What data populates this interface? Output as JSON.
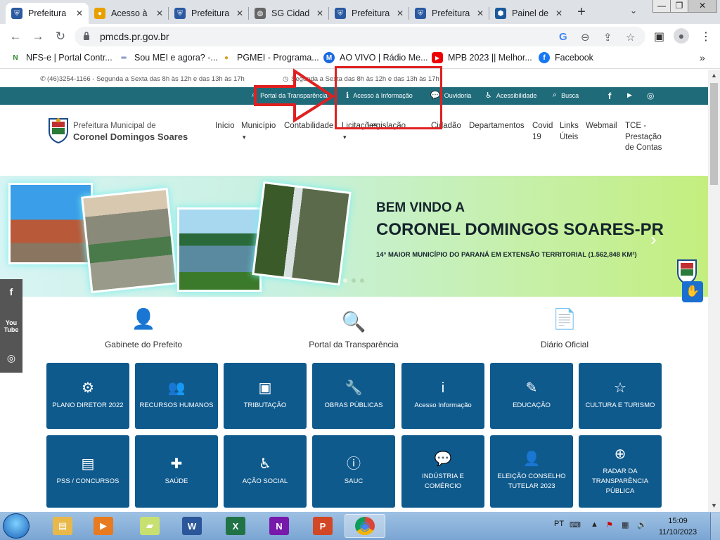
{
  "browser": {
    "tabs": [
      {
        "title": "Prefeitura",
        "active": true,
        "icon": "coat-of-arms-icon"
      },
      {
        "title": "Acesso à",
        "icon": "magnifier-icon"
      },
      {
        "title": "Prefeitura",
        "icon": "coat-of-arms-icon"
      },
      {
        "title": "SG Cidad",
        "icon": "globe-icon"
      },
      {
        "title": "Prefeitura",
        "icon": "coat-of-arms-icon"
      },
      {
        "title": "Prefeitura",
        "icon": "coat-of-arms-icon"
      },
      {
        "title": "Painel de",
        "icon": "hexagon-icon"
      }
    ],
    "new_tab": "+",
    "window_controls": {
      "minimize": "—",
      "restore": "❐",
      "close": "✕"
    },
    "url": "pmcds.pr.gov.br",
    "bookmarks": [
      {
        "label": "NFS-e | Portal Contr...",
        "icon": "nfse-icon"
      },
      {
        "label": "Sou MEI e agora? -...",
        "icon": "mei-icon"
      },
      {
        "label": "PGMEI - Programa...",
        "icon": "pgmei-icon"
      },
      {
        "label": "AO VIVO | Rádio Me...",
        "icon": "radio-icon"
      },
      {
        "label": "MPB 2023 || Melhor...",
        "icon": "youtube-icon"
      },
      {
        "label": "Facebook",
        "icon": "facebook-icon"
      }
    ],
    "bookmarks_more": "»"
  },
  "site": {
    "info_left": "(46)3254-1166 - Segunda a Sexta das 8h às 12h e das 13h às 17h",
    "info_right": "Segunda a Sexta das 8h às 12h e das 13h às 17h",
    "topnav": [
      {
        "label": "Portal da Transparência",
        "icon": "search-icon"
      },
      {
        "label": "Acesso à Informação",
        "icon": "info-icon"
      },
      {
        "label": "Ouvidoria",
        "icon": "chat-icon"
      },
      {
        "label": "Acessibilidade",
        "icon": "wheelchair-icon"
      },
      {
        "label": "Busca",
        "icon": "search-icon"
      }
    ],
    "logo_line1": "Prefeitura Municipal de",
    "logo_line2": "Coronel Domingos Soares",
    "menu": [
      {
        "label": "Início"
      },
      {
        "label": "Município",
        "caret": "▾"
      },
      {
        "label": "Contabilidade"
      },
      {
        "label": "Licitações",
        "caret": "▾"
      },
      {
        "label": "Legislação"
      },
      {
        "label": "Cidadão"
      },
      {
        "label": "Departamentos"
      },
      {
        "label": "Covid 19"
      },
      {
        "label": "Links Úteis"
      },
      {
        "label": "Webmail"
      },
      {
        "label": "TCE - Prestação de Contas"
      }
    ],
    "banner": {
      "line1": "BEM VINDO A",
      "line2": "CORONEL DOMINGOS SOARES-PR",
      "line3": "14° MAIOR MUNICÍPIO DO PARANÁ EM EXTENSÃO TERRITORIAL (1.562,848 KM²)",
      "next": "›"
    },
    "featured": [
      {
        "label": "Gabinete do Prefeito",
        "icon": "mayor-icon"
      },
      {
        "label": "Portal da Transparência",
        "icon": "transparency-icon"
      },
      {
        "label": "Diário Oficial",
        "icon": "gazette-icon"
      }
    ],
    "cards": [
      {
        "label": "PLANO DIRETOR 2022",
        "icon": "gears-icon",
        "glyph": "⚙"
      },
      {
        "label": "RECURSOS HUMANOS",
        "icon": "users-icon",
        "glyph": "👥"
      },
      {
        "label": "TRIBUTAÇÃO",
        "icon": "money-icon",
        "glyph": "▣"
      },
      {
        "label": "OBRAS PÚBLICAS",
        "icon": "wrench-icon",
        "glyph": "🔧"
      },
      {
        "label": "Acesso Informação",
        "icon": "info-icon",
        "glyph": "i"
      },
      {
        "label": "EDUCAÇÃO",
        "icon": "pencil-icon",
        "glyph": "✎"
      },
      {
        "label": "CULTURA E TURISMO",
        "icon": "star-icon",
        "glyph": "☆"
      },
      {
        "label": "PSS / CONCURSOS",
        "icon": "book-icon",
        "glyph": "▤"
      },
      {
        "label": "SAÚDE",
        "icon": "medkit-icon",
        "glyph": "✚"
      },
      {
        "label": "AÇÃO SOCIAL",
        "icon": "wheelchair-icon",
        "glyph": "♿"
      },
      {
        "label": "SAUC",
        "icon": "info-circle-icon",
        "glyph": "ⓘ"
      },
      {
        "label": "INDÚSTRIA E COMÉRCIO",
        "icon": "comments-icon",
        "glyph": "💬"
      },
      {
        "label": "ELEIÇÃO CONSELHO TUTELAR 2023",
        "icon": "user-icon",
        "glyph": "👤"
      },
      {
        "label": "RADAR DA TRANSPARÊNCIA PÚBLICA",
        "icon": "zoom-icon",
        "glyph": "⊕"
      }
    ],
    "social_side": [
      {
        "label": "f",
        "icon": "facebook-icon"
      },
      {
        "label": "You Tube",
        "icon": "youtube-icon"
      },
      {
        "label": "◎",
        "icon": "instagram-icon"
      }
    ]
  },
  "taskbar": {
    "apps": [
      {
        "icon": "explorer-icon"
      },
      {
        "icon": "media-player-icon"
      },
      {
        "icon": "sticky-notes-icon"
      },
      {
        "icon": "word-icon"
      },
      {
        "icon": "excel-icon"
      },
      {
        "icon": "onenote-icon"
      },
      {
        "icon": "powerpoint-icon"
      },
      {
        "icon": "chrome-icon",
        "active": true
      }
    ],
    "lang": "PT",
    "time": "15:09",
    "date": "11/10/2023"
  }
}
